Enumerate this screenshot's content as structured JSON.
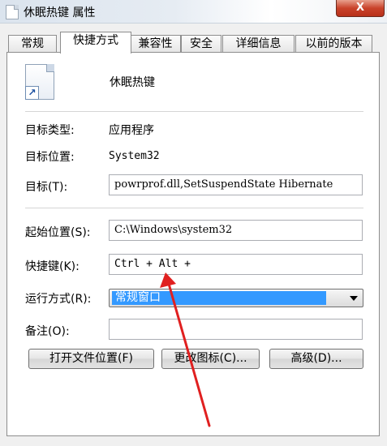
{
  "window": {
    "title": "休眠热键 属性",
    "close_label": "X"
  },
  "tabs": [
    {
      "label": "常规"
    },
    {
      "label": "快捷方式",
      "active": true
    },
    {
      "label": "兼容性"
    },
    {
      "label": "安全"
    },
    {
      "label": "详细信息"
    },
    {
      "label": "以前的版本"
    }
  ],
  "shortcut": {
    "name": "休眠热键",
    "target_type_label": "目标类型:",
    "target_type_value": "应用程序",
    "target_location_label": "目标位置:",
    "target_location_value": "System32",
    "target_label": "目标(T):",
    "target_value": "powrprof.dll,SetSuspendState Hibernate",
    "start_in_label": "起始位置(S):",
    "start_in_value": "C:\\Windows\\system32",
    "hotkey_label": "快捷键(K):",
    "hotkey_value": "Ctrl + Alt +",
    "run_label": "运行方式(R):",
    "run_value": "常规窗口",
    "comment_label": "备注(O):",
    "comment_value": ""
  },
  "buttons": {
    "open_location": "打开文件位置(F)",
    "change_icon": "更改图标(C)...",
    "advanced": "高级(D)..."
  },
  "colors": {
    "annotation_arrow": "#e02020",
    "selection": "#3399ff"
  }
}
